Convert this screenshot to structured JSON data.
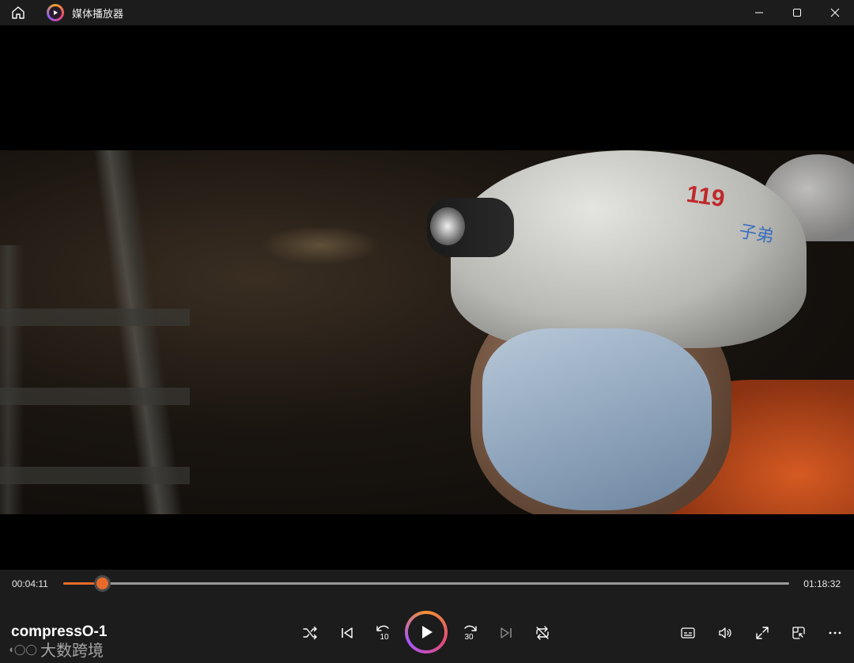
{
  "window": {
    "title": "媒体播放器",
    "icons": [
      "home-icon",
      "media-player-app-icon",
      "minimize-icon",
      "maximize-icon",
      "close-icon"
    ]
  },
  "video": {
    "helmet_text": "119",
    "helmet_text2": "子弟"
  },
  "seek": {
    "current_time": "00:04:11",
    "total_time": "01:18:32",
    "progress": 0.0533,
    "accent_color": "#e86a2a"
  },
  "now_playing": {
    "title": "compressO-1"
  },
  "watermark": {
    "text": "大数跨境"
  },
  "controls": {
    "center": [
      "shuffle-icon",
      "previous-icon",
      "skip-back-10-icon",
      "play-icon",
      "skip-forward-30-icon",
      "next-icon",
      "repeat-icon"
    ],
    "skip_back_label": "10",
    "skip_forward_label": "30",
    "right": [
      "subtitles-icon",
      "volume-icon",
      "fullscreen-icon",
      "mini-player-icon",
      "more-icon"
    ]
  }
}
